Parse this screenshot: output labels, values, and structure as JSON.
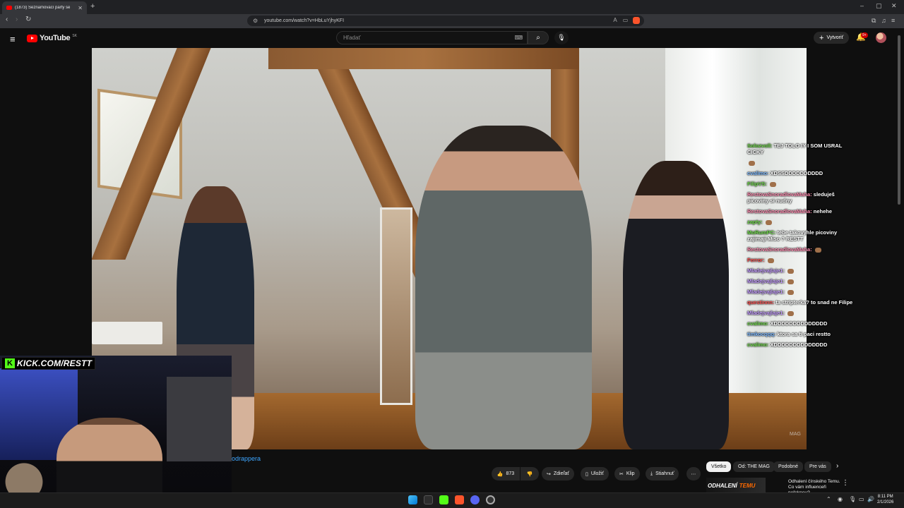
{
  "browser": {
    "tab_title": "(1873) Seznamovací party se",
    "url": "youtube.com/watch?v=HbLuYjhyKFI",
    "new_tab": "+",
    "close": "✕",
    "minimize": "–",
    "maximize": "▢",
    "close_window": "✕"
  },
  "youtube": {
    "logo_text": "YouTube",
    "region": "SK",
    "search_placeholder": "Hľadať",
    "create_label": "Vytvoriť",
    "notif_count": "9+"
  },
  "video": {
    "watermark": "MAG"
  },
  "kick": {
    "badge_text": "KICK.COM/RESTT"
  },
  "chat": [
    {
      "user": "Solozvoll:",
      "text": "TEJ TOLO IY I SOM USRAL CICKY",
      "color": "green"
    },
    {
      "user": "",
      "text": "",
      "color": "green",
      "emote": true
    },
    {
      "user": "cvalimo:",
      "text": "XDSSDDDDDDDDDD",
      "color": "blue"
    },
    {
      "user": "FilipVS:",
      "text": "",
      "color": "green",
      "emote": true
    },
    {
      "user": "RestovaSnoradlovaMaha:",
      "text": "sleduješ picoviny si nudny",
      "color": "pink"
    },
    {
      "user": "RestovaSnoradlovaMaha:",
      "text": "nehehe",
      "color": "pink"
    },
    {
      "user": "zapty:",
      "text": "",
      "color": "green",
      "emote": true
    },
    {
      "user": "MoRumPC:",
      "text": "tebe takovyhle picoviny zajimaji Miso ? RESTT",
      "color": "green"
    },
    {
      "user": "RestovaSnoradlovaMaha:",
      "text": "",
      "color": "pink",
      "emote": true
    },
    {
      "user": "Ferror:",
      "text": "",
      "color": "red",
      "emote": true
    },
    {
      "user": "Mladejvajlaje1:",
      "text": "",
      "color": "purple",
      "emote": true
    },
    {
      "user": "Mladejvajlaje1:",
      "text": "",
      "color": "purple",
      "emote": true
    },
    {
      "user": "Mladejvajlaje1:",
      "text": "",
      "color": "purple",
      "emote": true
    },
    {
      "user": "questinnn:",
      "text": "ta stripterka? to snad ne Filipe",
      "color": "red"
    },
    {
      "user": "Mladejvajlaje1:",
      "text": "",
      "color": "purple",
      "emote": true
    },
    {
      "user": "cvalimo:",
      "text": "XDDDDDDDDDDDDDD",
      "color": "green"
    },
    {
      "user": "timkocqqq:",
      "text": "ktora sa ti paci restto",
      "color": "blue"
    },
    {
      "user": "cvalimo:",
      "text": "XDDDDDDDDDDDDDD",
      "color": "green"
    }
  ],
  "below": {
    "channel_link": "odrappera",
    "likes": "873",
    "share": "Zdieľať",
    "save": "Uložiť",
    "clip": "Klip",
    "download": "Stiahnuť",
    "more": "⋯"
  },
  "chips": [
    "Všetko",
    "Od: THE MAG",
    "Podobné",
    "Pre vás"
  ],
  "recommendation": {
    "thumb_text_a": "ODHALENÍ",
    "thumb_text_b": "TEMU",
    "title": "Odhalení čínského Temu. Co vám influenceři neřeknou?"
  },
  "taskbar": {
    "time": "8:11 PM",
    "date": "2/1/2026"
  },
  "colors": {
    "accent_red": "#ff0000",
    "link_blue": "#3ea6ff",
    "kick_green": "#53fc18"
  }
}
